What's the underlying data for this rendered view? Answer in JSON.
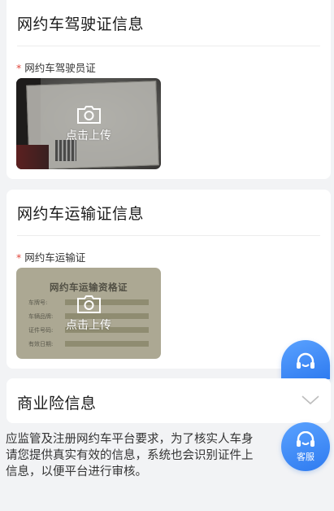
{
  "driver_license_section": {
    "title": "网约车驾驶证信息",
    "field_label": "网约车驾驶员证",
    "required_mark": "*",
    "upload_text": "点击上传"
  },
  "transport_cert_section": {
    "title": "网约车运输证信息",
    "field_label": "网约车运输证",
    "required_mark": "*",
    "upload_text": "点击上传",
    "sample_card": {
      "title": "网约车运输资格证",
      "rows": [
        "车牌号:",
        "车辆品牌:",
        "证件号码:",
        "有效日期:"
      ]
    }
  },
  "insurance_section": {
    "title": "商业险信息"
  },
  "notice_lines": [
    "应监管及注册网约车平台要求，为了核实人车身",
    "请您提供真实有效的信息，系统也会识别证件上",
    "信息，以便平台进行审核。"
  ],
  "customer_service": {
    "label": "客服"
  }
}
